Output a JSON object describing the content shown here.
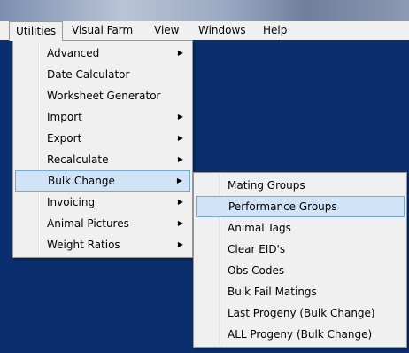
{
  "menubar": {
    "items": [
      {
        "label": "Utilities"
      },
      {
        "label": "Visual Farm"
      },
      {
        "label": "View"
      },
      {
        "label": "Windows"
      },
      {
        "label": "Help"
      }
    ]
  },
  "utilities_menu": {
    "items": [
      {
        "label": "Advanced",
        "submenu": true
      },
      {
        "label": "Date Calculator",
        "submenu": false
      },
      {
        "label": "Worksheet Generator",
        "submenu": false
      },
      {
        "label": "Import",
        "submenu": true
      },
      {
        "label": "Export",
        "submenu": true
      },
      {
        "label": "Recalculate",
        "submenu": true
      },
      {
        "label": "Bulk Change",
        "submenu": true,
        "highlighted": true
      },
      {
        "label": "Invoicing",
        "submenu": true
      },
      {
        "label": "Animal Pictures",
        "submenu": true
      },
      {
        "label": "Weight Ratios",
        "submenu": true
      }
    ],
    "arrow_glyph": "▶"
  },
  "bulk_change_menu": {
    "items": [
      {
        "label": "Mating Groups"
      },
      {
        "label": "Performance Groups",
        "highlighted": true
      },
      {
        "label": "Animal Tags"
      },
      {
        "label": "Clear EID's"
      },
      {
        "label": "Obs Codes"
      },
      {
        "label": "Bulk Fail Matings"
      },
      {
        "label": "Last Progeny (Bulk Change)"
      },
      {
        "label": "ALL Progeny (Bulk Change)"
      }
    ]
  },
  "colors": {
    "workspace": "#0b2f6e",
    "menu_bg": "#f0f0f0",
    "highlight_bg": "#d1e4f7",
    "highlight_border": "#79a8db"
  }
}
